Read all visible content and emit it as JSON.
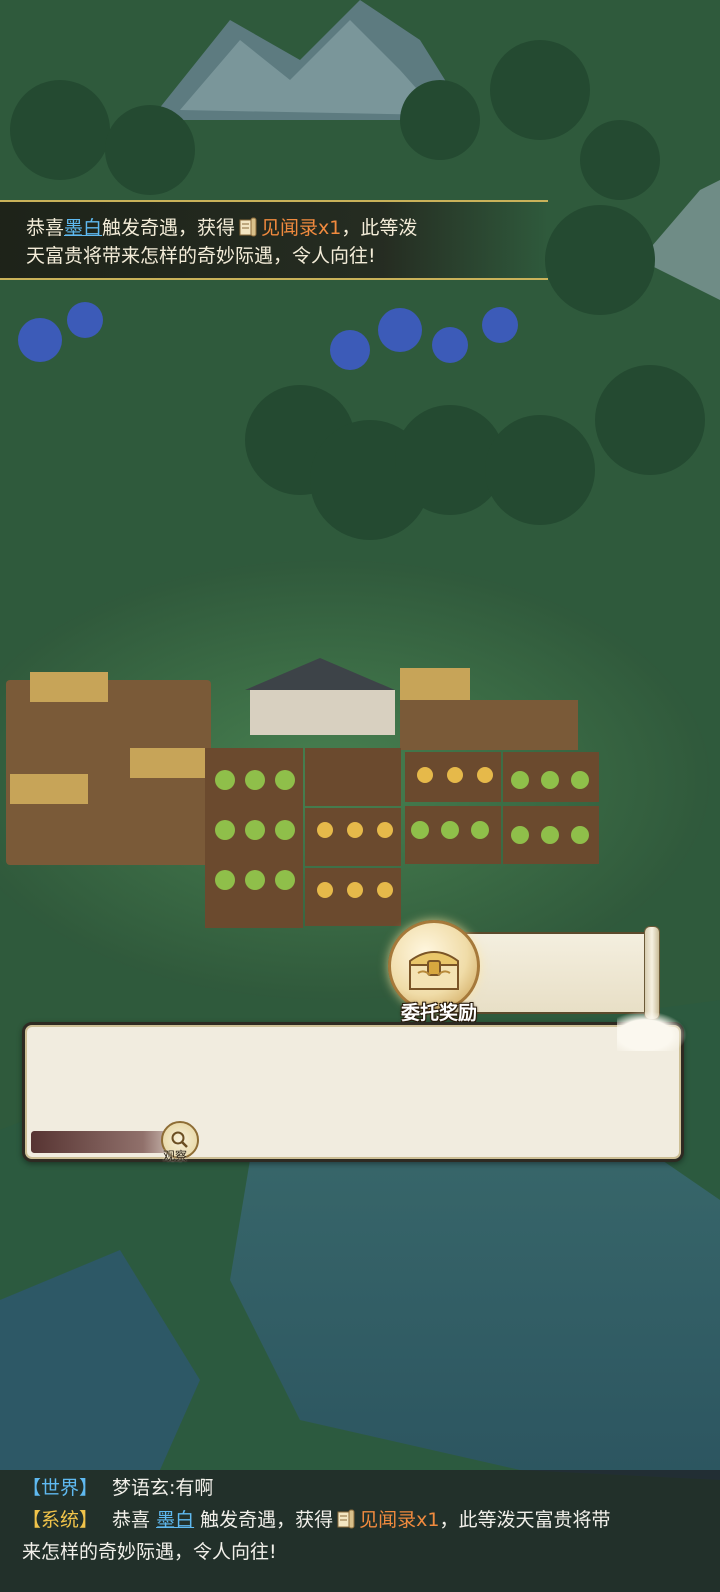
{
  "announcement": {
    "prefix": "恭喜",
    "player": "墨白",
    "mid": "触发奇遇，获得",
    "item_icon": "scroll-icon",
    "item": "见闻录x1",
    "suffix_line1": "，此等泼",
    "line2": "天富贵将带来怎样的奇妙际遇，令人向往!"
  },
  "reward": {
    "label": "委托奖励",
    "icon": "treasure-chest-icon"
  },
  "dialog": {
    "observe_label": "观察",
    "observe_icon": "magnifier-icon"
  },
  "chat": {
    "world": {
      "channel": "【世界】",
      "speaker": "梦语玄:",
      "text": "有啊"
    },
    "system": {
      "channel": "【系统】",
      "prefix": "恭喜",
      "player": "墨白",
      "mid": "触发奇遇，获得",
      "item": "见闻录x1",
      "suffix": "，此等泼天富贵将带",
      "line2": "来怎样的奇妙际遇，令人向往!"
    }
  },
  "colors": {
    "player_link": "#5fb9f0",
    "item_highlight": "#f08a3e",
    "system_channel": "#f0c34a",
    "banner_border": "#c9b25a"
  }
}
